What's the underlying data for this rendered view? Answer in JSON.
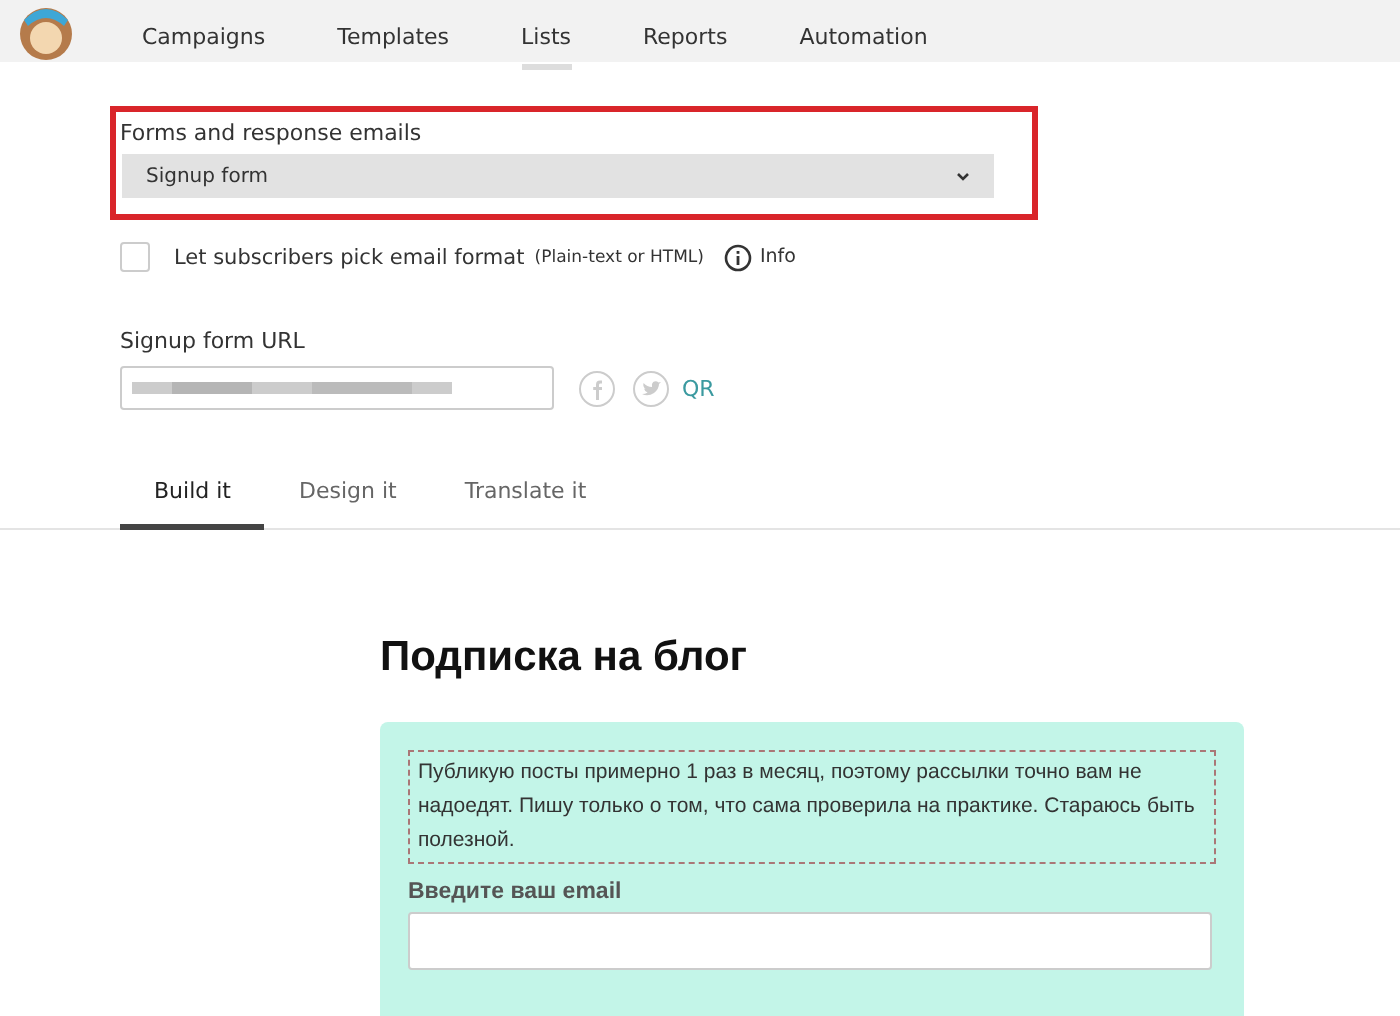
{
  "nav": {
    "items": [
      {
        "label": "Campaigns",
        "selected": false
      },
      {
        "label": "Templates",
        "selected": false
      },
      {
        "label": "Lists",
        "selected": true
      },
      {
        "label": "Reports",
        "selected": false
      },
      {
        "label": "Automation",
        "selected": false
      }
    ]
  },
  "forms_select": {
    "label": "Forms and response emails",
    "value": "Signup form"
  },
  "format_option": {
    "label": "Let subscribers pick email format",
    "hint": "(Plain-text or HTML)",
    "checked": false,
    "info": "Info"
  },
  "url": {
    "label": "Signup form URL",
    "qr": "QR"
  },
  "tabs": [
    {
      "label": "Build it",
      "selected": true
    },
    {
      "label": "Design it",
      "selected": false
    },
    {
      "label": "Translate it",
      "selected": false
    }
  ],
  "preview": {
    "title": "Подписка на блог",
    "description": "Публикую посты примерно 1 раз в месяц, поэтому рассылки точно вам не надоедят. Пишу только о том, что сама проверила на практике. Стараюсь быть полезной.",
    "email_label": "Введите ваш email"
  }
}
